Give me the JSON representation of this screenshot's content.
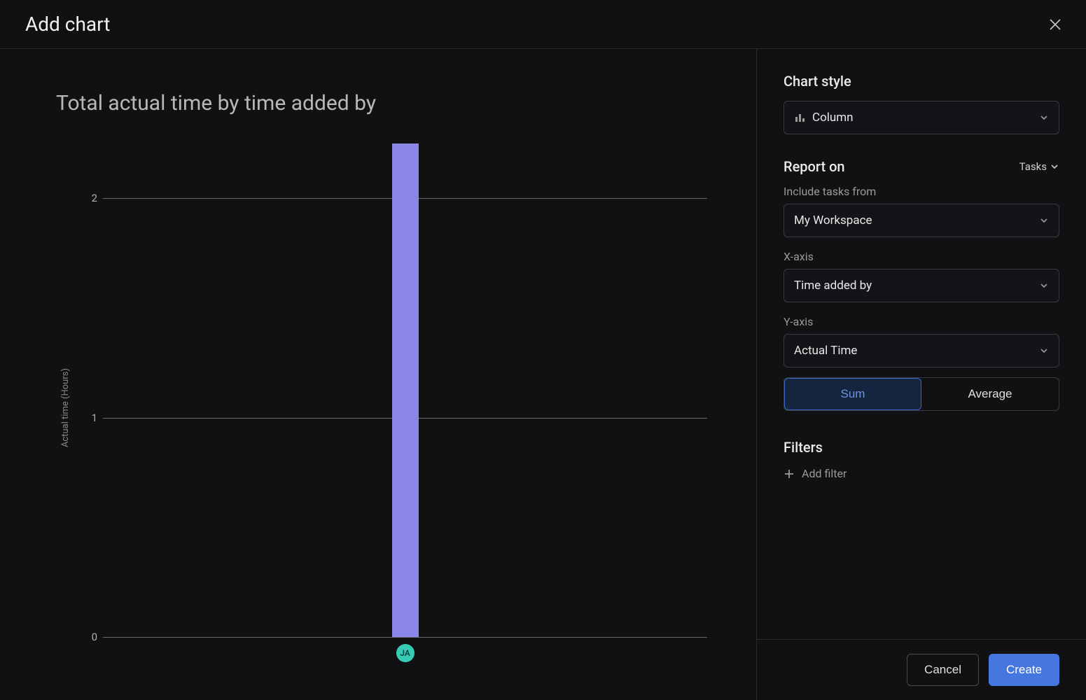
{
  "modal": {
    "title": "Add chart",
    "cancel": "Cancel",
    "create": "Create"
  },
  "chart": {
    "title": "Total actual time by time added by",
    "ylabel": "Actual time (Hours)"
  },
  "chart_data": {
    "type": "bar",
    "categories": [
      "JA"
    ],
    "values": [
      2.25
    ],
    "title": "Total actual time by time added by",
    "xlabel": "Time added by",
    "ylabel": "Actual time (Hours)",
    "ylim": [
      0,
      2.25
    ],
    "y_ticks": [
      0,
      1,
      2
    ],
    "bar_color": "#8b86e8",
    "yticklabels": [
      "0",
      "1",
      "2"
    ]
  },
  "config": {
    "chart_style_label": "Chart style",
    "chart_style_value": "Column",
    "report_on_label": "Report on",
    "report_on_value": "Tasks",
    "include_label": "Include tasks from",
    "include_value": "My Workspace",
    "xaxis_label": "X-axis",
    "xaxis_value": "Time added by",
    "yaxis_label": "Y-axis",
    "yaxis_value": "Actual Time",
    "agg_sum": "Sum",
    "agg_avg": "Average",
    "filters_label": "Filters",
    "add_filter": "Add filter"
  }
}
